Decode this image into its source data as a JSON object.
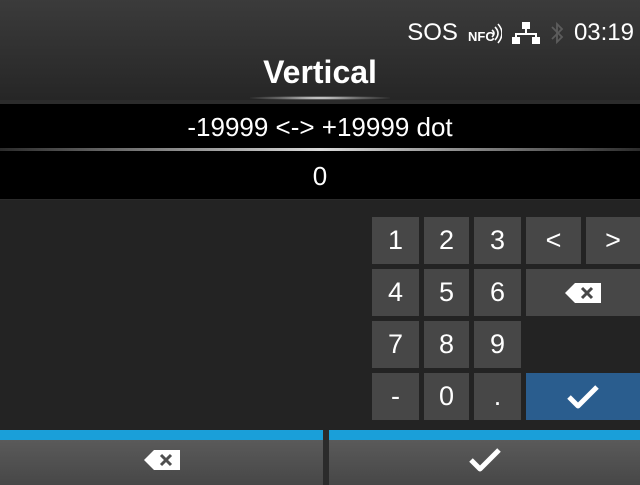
{
  "status_bar": {
    "sos": "SOS",
    "nfc_icon": "nfc-icon",
    "network_icon": "network-icon",
    "bluetooth_icon": "bluetooth-icon",
    "time": "03:19"
  },
  "header": {
    "title": "Vertical"
  },
  "range": {
    "text": "-19999 <-> +19999 dot"
  },
  "input": {
    "value": "0"
  },
  "keypad": {
    "keys": [
      "1",
      "2",
      "3",
      "<",
      ">",
      "4",
      "5",
      "6",
      "7",
      "8",
      "9",
      "-",
      "0",
      "."
    ],
    "backspace_icon": "backspace-icon",
    "enter_icon": "checkmark-icon"
  },
  "bottom_bar": {
    "left_icon": "backspace-icon",
    "right_icon": "checkmark-icon"
  },
  "colors": {
    "accent": "#1a9fd9",
    "enter_key": "#2a5d8e",
    "key": "#474747"
  }
}
